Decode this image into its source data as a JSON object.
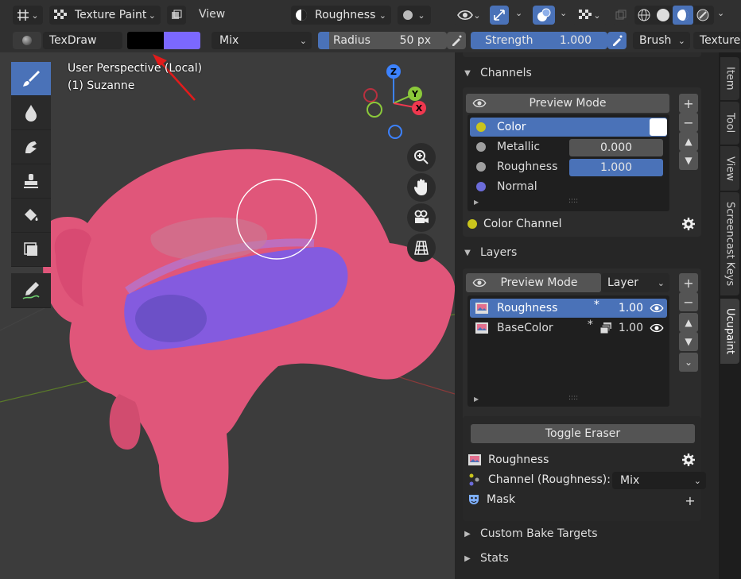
{
  "header": {
    "mode_label": "Texture Paint",
    "view_menu": "View",
    "channel_label": "Roughness"
  },
  "tool_settings": {
    "brush_name": "TexDraw",
    "color_primary": "#000000",
    "color_secondary": "#7b68ff",
    "blend": "Mix",
    "radius_label": "Radius",
    "radius_value": "50 px",
    "strength_label": "Strength",
    "strength_value": "1.000",
    "brush_menu": "Brush",
    "texture_menu": "Texture"
  },
  "viewport": {
    "line1": "User Perspective (Local)",
    "line2": "(1) Suzanne",
    "gizmo": {
      "z": "Z",
      "y": "Y",
      "x": "X"
    }
  },
  "channels": {
    "title": "Channels",
    "preview_button": "Preview Mode",
    "items": [
      {
        "name": "Color",
        "color": "#c9c41c"
      },
      {
        "name": "Metallic",
        "value": "0.000",
        "color": "#a0a0a0"
      },
      {
        "name": "Roughness",
        "value": "1.000",
        "color": "#a0a0a0"
      },
      {
        "name": "Normal",
        "color": "#6b6bd9"
      }
    ],
    "footer_label": "Color Channel"
  },
  "layers": {
    "title": "Layers",
    "preview_button": "Preview Mode",
    "layer_dropdown": "Layer",
    "items": [
      {
        "name": "Roughness",
        "value": "1.00"
      },
      {
        "name": "BaseColor",
        "value": "1.00"
      }
    ],
    "toggle_eraser": "Toggle Eraser",
    "active_layer": "Roughness",
    "channel_label": "Channel (Roughness):",
    "channel_blend": "Mix",
    "mask_label": "Mask"
  },
  "sections": {
    "custom_bake": "Custom Bake Targets",
    "stats": "Stats"
  },
  "tabs": [
    "Item",
    "Tool",
    "View",
    "Screencast Keys",
    "Ucupaint"
  ]
}
